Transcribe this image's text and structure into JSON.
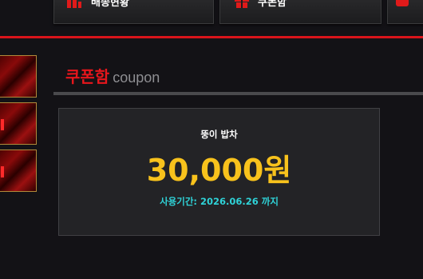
{
  "nav": {
    "tabs": [
      {
        "label": "배송현황",
        "icon": "bar-chart-icon"
      },
      {
        "label": "쿠폰함",
        "icon": "gift-icon"
      },
      {
        "label": "",
        "icon": "red-square-icon"
      }
    ]
  },
  "section": {
    "title_kr": "쿠폰함",
    "title_en": "coupon"
  },
  "coupon": {
    "name": "뚱이 밥차",
    "amount": "30,000원",
    "expiry": "사용기간: 2026.06.26 까지"
  },
  "colors": {
    "accent_red": "#e8161c",
    "amount_yellow": "#f8c21c",
    "expiry_cyan": "#2fd3d8",
    "background": "#131216"
  }
}
